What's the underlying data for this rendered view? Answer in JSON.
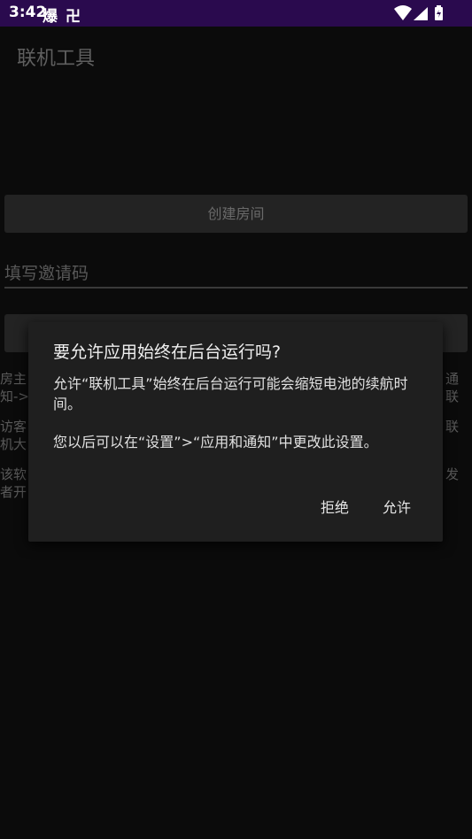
{
  "status_bar": {
    "time": "3:42",
    "notif_1": "爆",
    "notif_2": "卍",
    "icons": [
      "wifi-icon",
      "signal-icon",
      "battery-icon"
    ]
  },
  "app": {
    "title": "联机工具",
    "create_room_label": "创建房间",
    "invite_placeholder": "填写邀请码",
    "join_label": "",
    "bg_text": {
      "left_1": "房主\n知->",
      "right_1": "通\n联",
      "left_2": "访客\n机大",
      "right_2": "联",
      "left_3": "该软\n者开",
      "right_3": "发"
    }
  },
  "dialog": {
    "title": "要允许应用始终在后台运行吗?",
    "message_1": "允许“联机工具”始终在后台运行可能会缩短电池的续航时间。",
    "message_2": "您以后可以在“设置”>“应用和通知”中更改此设置。",
    "deny_label": "拒绝",
    "allow_label": "允许"
  },
  "colors": {
    "status_bar": "#2a0a4e",
    "background": "#0b0b0b",
    "dialog": "#1f1f1f"
  }
}
